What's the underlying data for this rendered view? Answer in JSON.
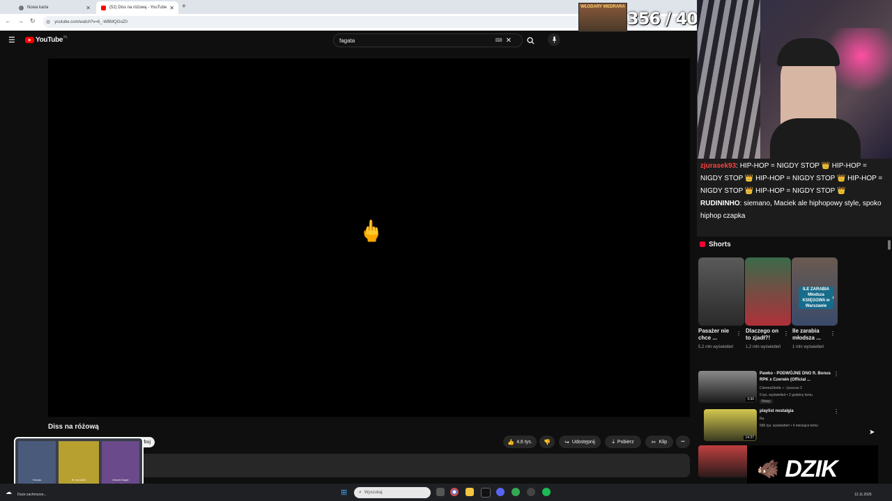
{
  "browser": {
    "tabs": [
      {
        "title": "Nowa karta",
        "close": "✕"
      },
      {
        "title": "(52) Diss na różową - YouTube",
        "close": "✕"
      }
    ],
    "new_tab": "+",
    "url": "youtube.com/watch?v=6_-WBMQGoZ0"
  },
  "youtube": {
    "logo": "YouTube",
    "region": "PL",
    "search_value": "fagata",
    "video_title": "Diss na różową",
    "actions": {
      "likes": "4,6 tys.",
      "share": "Udostępnij",
      "download": "Pobierz",
      "clip": "Klip",
      "more": "•••"
    },
    "subscribe_partial": "ybuj"
  },
  "overlay": {
    "goal_label": "WŁODARY WEDRARA",
    "counter": "356 / 400",
    "chat": [
      {
        "user": "zjurasek93",
        "text": ": HIP-HOP = NIGDY STOP 👑 HIP-HOP = NIGDY STOP 👑 HIP-HOP = NIGDY STOP 👑 HIP-HOP = NIGDY STOP 👑 HIP-HOP = NIGDY STOP 👑"
      },
      {
        "user": "RUDININHO",
        "text": ": siemano, Maciek ale hiphopowy style, spoko hiphop czapka"
      }
    ],
    "brand": "DZIK",
    "case_items": [
      {
        "name": "Famas",
        "sub": "Sergeant"
      },
      {
        "name": "★ Karambit",
        "sub": "Case Hardened"
      },
      {
        "name": "Desert Eagle",
        "sub": "Ocean Dragon"
      }
    ]
  },
  "sidebar": {
    "shorts_title": "Shorts",
    "shorts": [
      {
        "title": "Pasażer nie chce ...",
        "views": "5,2 mln wyświetleń"
      },
      {
        "title": "Dlaczego on to zjadł?!",
        "views": "1,2 mln wyświetleń"
      },
      {
        "title": "Ile zarabia młodsza ...",
        "views": "1 mln wyświetleń"
      }
    ],
    "shorts_thumb3_text": "ILE ZARABIA Młodsza KSIĘGOWA w Warszawie",
    "recommended": [
      {
        "title": "Pawko - PODWÓJNE DNO ft. Bonus RPK x Czerwin (Official ...",
        "channel": "CiemnaStrefa ✓ i jeszcze 2",
        "meta": "5 tys. wyświetleń • 2 godziny temu",
        "badge": "Nowy",
        "duration": "3:30"
      },
      {
        "title": "playlist nostalgia",
        "channel": "Ra",
        "meta": "586 tys. wyświetleń • 4 miesiące temu",
        "badge": "",
        "duration": "14:37"
      }
    ]
  },
  "taskbar": {
    "search_placeholder": "Wyszukaj",
    "weather": "Duże zachmurze...",
    "date": "12.11.2025"
  }
}
